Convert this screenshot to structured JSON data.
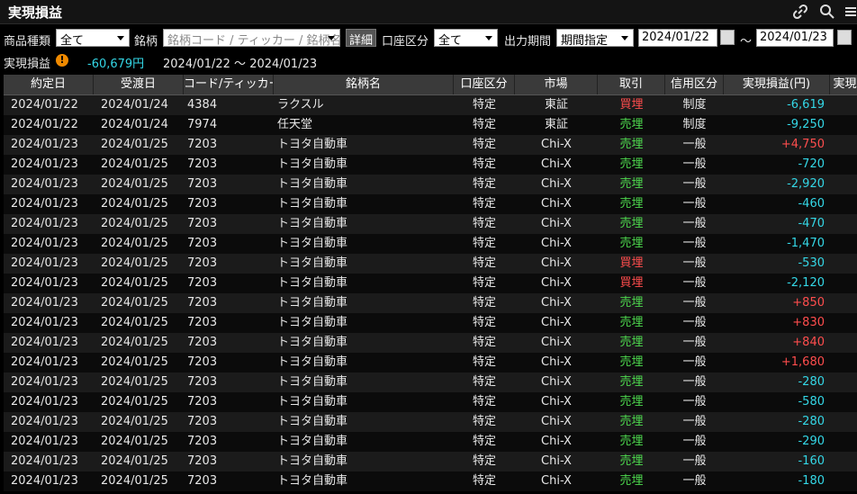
{
  "window": {
    "title": "実現損益"
  },
  "filters": {
    "product_type_label": "商品種類",
    "product_type_value": "全て",
    "brand_label": "銘柄",
    "brand_placeholder": "銘柄コード / ティッカー / 銘柄名",
    "detail_button": "詳細",
    "account_label": "口座区分",
    "account_value": "全て",
    "period_label": "出力期間",
    "period_value": "期間指定",
    "date_from": "2024/01/22",
    "date_sep": "～",
    "date_to": "2024/01/23"
  },
  "summary": {
    "label": "実現損益",
    "warning_icon": "!",
    "total": "-60,679円",
    "period": "2024/01/22 ～ 2024/01/23"
  },
  "table": {
    "columns": [
      "約定日",
      "受渡日",
      "コード/ティッカー",
      "銘柄名",
      "口座区分",
      "市場",
      "取引",
      "信用区分",
      "実現損益(円)",
      "実現"
    ],
    "rows": [
      [
        "2024/01/22",
        "2024/01/24",
        "4384",
        "ラクスル",
        "特定",
        "東証",
        "買埋",
        "制度",
        "-6,619"
      ],
      [
        "2024/01/22",
        "2024/01/24",
        "7974",
        "任天堂",
        "特定",
        "東証",
        "売埋",
        "制度",
        "-9,250"
      ],
      [
        "2024/01/23",
        "2024/01/25",
        "7203",
        "トヨタ自動車",
        "特定",
        "Chi-X",
        "売埋",
        "一般",
        "+4,750"
      ],
      [
        "2024/01/23",
        "2024/01/25",
        "7203",
        "トヨタ自動車",
        "特定",
        "Chi-X",
        "売埋",
        "一般",
        "-720"
      ],
      [
        "2024/01/23",
        "2024/01/25",
        "7203",
        "トヨタ自動車",
        "特定",
        "Chi-X",
        "売埋",
        "一般",
        "-2,920"
      ],
      [
        "2024/01/23",
        "2024/01/25",
        "7203",
        "トヨタ自動車",
        "特定",
        "Chi-X",
        "売埋",
        "一般",
        "-460"
      ],
      [
        "2024/01/23",
        "2024/01/25",
        "7203",
        "トヨタ自動車",
        "特定",
        "Chi-X",
        "売埋",
        "一般",
        "-470"
      ],
      [
        "2024/01/23",
        "2024/01/25",
        "7203",
        "トヨタ自動車",
        "特定",
        "Chi-X",
        "売埋",
        "一般",
        "-1,470"
      ],
      [
        "2024/01/23",
        "2024/01/25",
        "7203",
        "トヨタ自動車",
        "特定",
        "Chi-X",
        "買埋",
        "一般",
        "-530"
      ],
      [
        "2024/01/23",
        "2024/01/25",
        "7203",
        "トヨタ自動車",
        "特定",
        "Chi-X",
        "買埋",
        "一般",
        "-2,120"
      ],
      [
        "2024/01/23",
        "2024/01/25",
        "7203",
        "トヨタ自動車",
        "特定",
        "Chi-X",
        "売埋",
        "一般",
        "+850"
      ],
      [
        "2024/01/23",
        "2024/01/25",
        "7203",
        "トヨタ自動車",
        "特定",
        "Chi-X",
        "売埋",
        "一般",
        "+830"
      ],
      [
        "2024/01/23",
        "2024/01/25",
        "7203",
        "トヨタ自動車",
        "特定",
        "Chi-X",
        "売埋",
        "一般",
        "+840"
      ],
      [
        "2024/01/23",
        "2024/01/25",
        "7203",
        "トヨタ自動車",
        "特定",
        "Chi-X",
        "売埋",
        "一般",
        "+1,680"
      ],
      [
        "2024/01/23",
        "2024/01/25",
        "7203",
        "トヨタ自動車",
        "特定",
        "Chi-X",
        "売埋",
        "一般",
        "-280"
      ],
      [
        "2024/01/23",
        "2024/01/25",
        "7203",
        "トヨタ自動車",
        "特定",
        "Chi-X",
        "売埋",
        "一般",
        "-580"
      ],
      [
        "2024/01/23",
        "2024/01/25",
        "7203",
        "トヨタ自動車",
        "特定",
        "Chi-X",
        "売埋",
        "一般",
        "-280"
      ],
      [
        "2024/01/23",
        "2024/01/25",
        "7203",
        "トヨタ自動車",
        "特定",
        "Chi-X",
        "売埋",
        "一般",
        "-290"
      ],
      [
        "2024/01/23",
        "2024/01/25",
        "7203",
        "トヨタ自動車",
        "特定",
        "Chi-X",
        "売埋",
        "一般",
        "-160"
      ],
      [
        "2024/01/23",
        "2024/01/25",
        "7203",
        "トヨタ自動車",
        "特定",
        "Chi-X",
        "売埋",
        "一般",
        "-180"
      ]
    ]
  },
  "icons": {
    "link": "link-icon",
    "search": "search-icon",
    "menu": "menu-icon",
    "calendar": "calendar-icon",
    "warning": "warning-icon"
  },
  "colors": {
    "buy": "#ff4d4d",
    "sell": "#4ed94e",
    "profit": "#ff4d4d",
    "loss": "#34d7e6",
    "header_bg": "#3a3a3a"
  }
}
